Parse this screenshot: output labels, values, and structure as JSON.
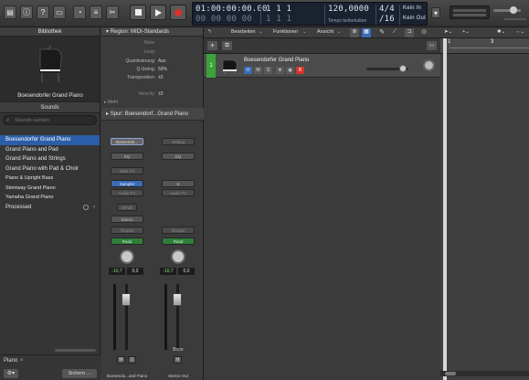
{
  "control_bar": {
    "lcd": {
      "time_main": "01:00:00:00.00",
      "time_sub": "00 00 00 00",
      "bars_main": "1  1  1",
      "bars_sub": "1  1  1",
      "tempo_value": "120,0000",
      "tempo_label": "Tempo beibehalten",
      "signature": "4/4",
      "division": "/16",
      "in_label": "Kein In",
      "out_label": "Kein Out"
    }
  },
  "library": {
    "title": "Bibliothek",
    "preview_name": "Boesendorfer Grand Piano",
    "sounds_tab": "Sounds",
    "search_placeholder": "Sounds suchen",
    "items": [
      "Boesendorfer Grand Piano",
      "Grand Piano and Pad",
      "Grand Piano and Strings",
      "Grand Piano with Pad & Choir",
      "Piano & Upright Bass",
      "Steinway Grand Piano",
      "Yamaha Grand Piano",
      "Processed"
    ],
    "footer_category": "Piano",
    "footer_button": "Sichern ..."
  },
  "inspector": {
    "region_header": "Region: MIDI-Standards",
    "region_rows": [
      {
        "label": "Mute:",
        "value": ""
      },
      {
        "label": "Loop:",
        "value": ""
      },
      {
        "label": "Quantisierung:",
        "value": "Aus"
      },
      {
        "label": "Q-Swing:",
        "value": "50%"
      },
      {
        "label": "Transposition:",
        "value": "±0"
      },
      {
        "label": "Velocity:",
        "value": "±0"
      }
    ],
    "more_label": "Mehr",
    "track_header": "Spur: Boesendorf...Grand Piano",
    "strips": [
      {
        "setting": "Boesendo...",
        "eq": "EQ",
        "midi_fx": "MIDI FX",
        "instrument": "Sampler",
        "audio_fx": "Audio FX",
        "sends": "Sends",
        "output": "Stereo",
        "group": "Gruppe",
        "automation": "Read",
        "volume": "-10,7",
        "pan": "0,0",
        "mute": "M",
        "solo": "S",
        "name": "Boesendo...and Piano"
      },
      {
        "setting": "Setting",
        "eq": "EQ",
        "link_icon": "link-icon",
        "audio_fx": "Audio FX",
        "group": "Gruppe",
        "automation": "Read",
        "volume": "-10,7",
        "pan": "0,0",
        "mute": "M",
        "bounce": "Bnce",
        "name": "Stereo Out"
      }
    ]
  },
  "tracks": {
    "menus": [
      "Bearbeiten",
      "Funktionen",
      "Ansicht"
    ],
    "track": {
      "number": "1",
      "name": "Boesendorfer Grand Piano",
      "mute": "M",
      "solo": "S",
      "record": "R"
    }
  },
  "ruler": {
    "bar_1": "1",
    "bar_3": "3"
  },
  "colors": {
    "accent_blue": "#2b5ea8",
    "track_green": "#3aa33a",
    "record_red": "#d8332b",
    "automation_green": "#2f7d3a"
  }
}
